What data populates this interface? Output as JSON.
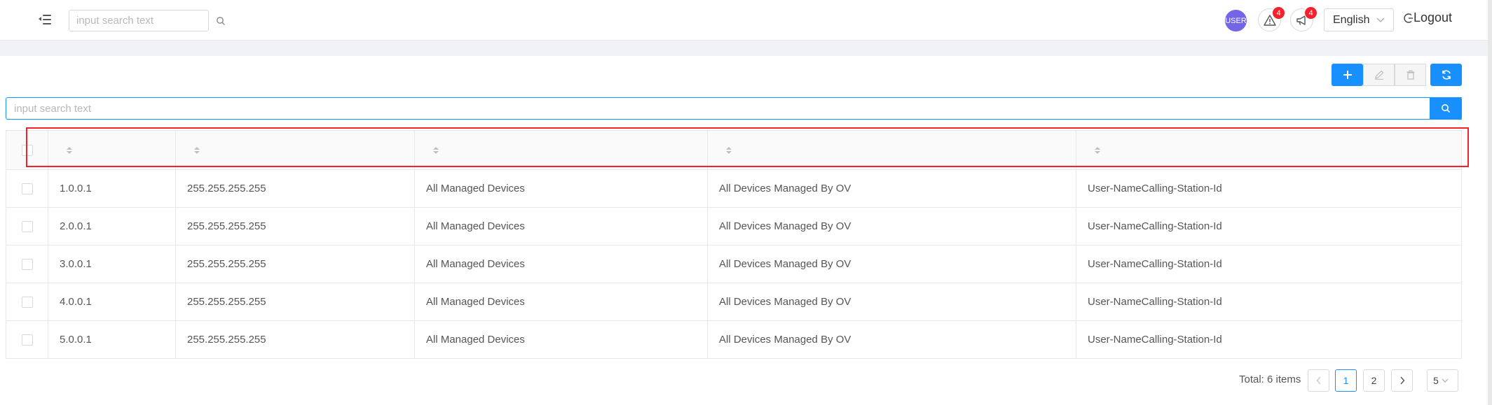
{
  "header": {
    "search_placeholder": "input search text",
    "avatar_label": "USER",
    "alerts_count": "4",
    "notifications_count": "4",
    "language": "English",
    "logout_label": "Logout"
  },
  "toolbar": {
    "add_icon": "plus-icon",
    "edit_icon": "edit-icon",
    "delete_icon": "delete-icon",
    "refresh_icon": "refresh-icon"
  },
  "search": {
    "placeholder": "input search text"
  },
  "table": {
    "headers": [
      "",
      "",
      "",
      "",
      ""
    ],
    "rows": [
      [
        "1.0.0.1",
        "255.255.255.255",
        "All Managed Devices",
        "All Devices Managed By OV",
        "User-NameCalling-Station-Id"
      ],
      [
        "2.0.0.1",
        "255.255.255.255",
        "All Managed Devices",
        "All Devices Managed By OV",
        "User-NameCalling-Station-Id"
      ],
      [
        "3.0.0.1",
        "255.255.255.255",
        "All Managed Devices",
        "All Devices Managed By OV",
        "User-NameCalling-Station-Id"
      ],
      [
        "4.0.0.1",
        "255.255.255.255",
        "All Managed Devices",
        "All Devices Managed By OV",
        "User-NameCalling-Station-Id"
      ],
      [
        "5.0.0.1",
        "255.255.255.255",
        "All Managed Devices",
        "All Devices Managed By OV",
        "User-NameCalling-Station-Id"
      ]
    ]
  },
  "pagination": {
    "total": "Total: 6 items",
    "prev": "<",
    "pages": [
      "1",
      "2"
    ],
    "current": "1",
    "next": ">",
    "page_size": "5"
  },
  "colors": {
    "primary": "#1890ff",
    "avatar": "#7265e6",
    "badge": "#f5222d",
    "highlight": "#f5222d"
  }
}
